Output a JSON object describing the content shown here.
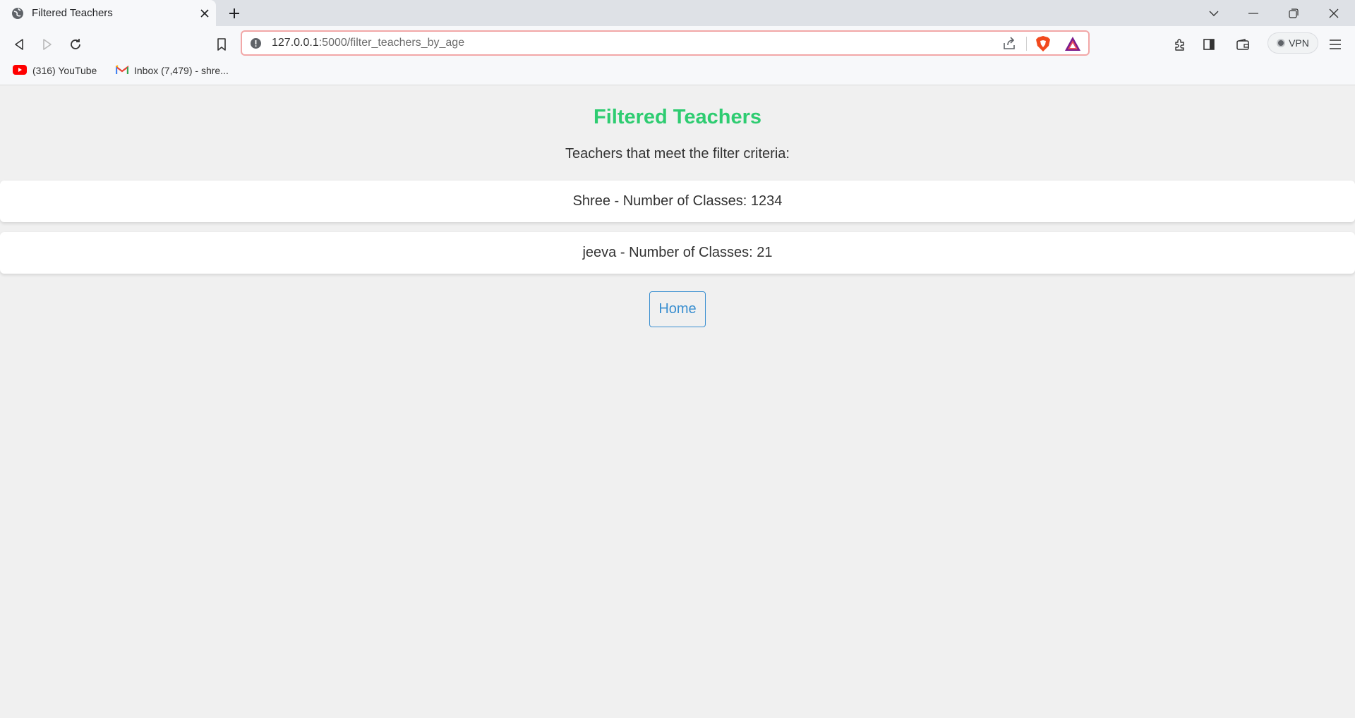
{
  "browser": {
    "tab_title": "Filtered Teachers",
    "url_host": "127.0.0.1",
    "url_path": ":5000/filter_teachers_by_age",
    "vpn_label": "VPN",
    "bookmarks": [
      {
        "label": "(316) YouTube",
        "icon": "youtube-icon"
      },
      {
        "label": "Inbox (7,479) - shre...",
        "icon": "gmail-icon"
      }
    ]
  },
  "page": {
    "title": "Filtered Teachers",
    "subtitle": "Teachers that meet the filter criteria:",
    "teachers": [
      {
        "text": "Shree - Number of Classes: 1234"
      },
      {
        "text": "jeeva - Number of Classes: 21"
      }
    ],
    "home_label": "Home"
  },
  "colors": {
    "title": "#2ecc71",
    "link": "#3a8fd0",
    "background": "#f0f0f0"
  }
}
